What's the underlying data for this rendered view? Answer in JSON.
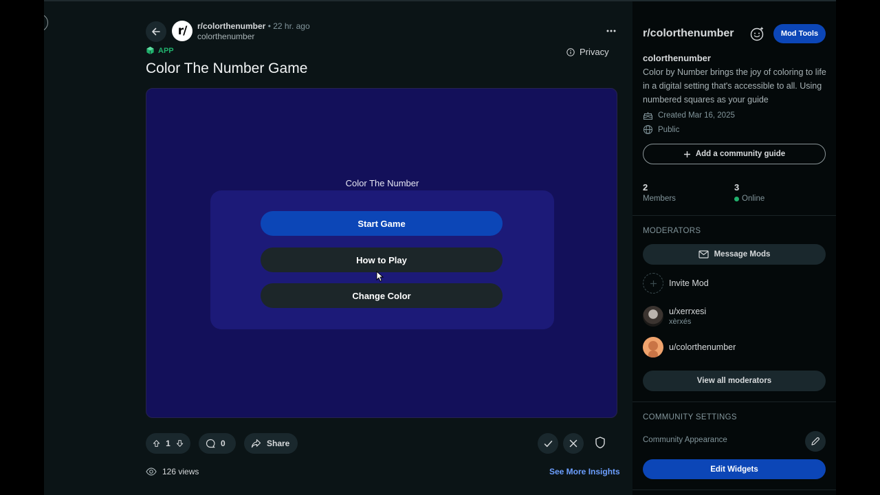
{
  "post": {
    "subreddit": "r/colorthenumber",
    "separator": "•",
    "time": "22 hr. ago",
    "author": "colorthenumber",
    "avatar_text": "r/",
    "badge": "APP",
    "privacy_label": "Privacy",
    "title": "Color The Number Game"
  },
  "game": {
    "title": "Color The Number",
    "buttons": {
      "start": "Start Game",
      "how_to_play": "How to Play",
      "change_color": "Change Color"
    },
    "colors": {
      "background": "#13105a",
      "panel": "#1c1a78",
      "primary": "#0c46b7"
    }
  },
  "actions": {
    "votes": "1",
    "comments": "0",
    "share": "Share",
    "views": "126 views",
    "insights": "See More Insights"
  },
  "sidebar": {
    "title": "r/colorthenumber",
    "mod_tools": "Mod Tools",
    "name": "colorthenumber",
    "description": "Color by Number brings the joy of coloring to life in a digital setting that's accessible to all. Using numbered squares as your guide",
    "created": "Created Mar 16, 2025",
    "visibility": "Public",
    "guide_button": "Add a community guide",
    "members_count": "2",
    "members_label": "Members",
    "online_count": "3",
    "online_label": "Online",
    "moderators_heading": "MODERATORS",
    "message_mods": "Message Mods",
    "invite_mod": "Invite Mod",
    "mods": [
      {
        "name": "u/xerrxesi",
        "display": "xèrxés"
      },
      {
        "name": "u/colorthenumber"
      }
    ],
    "view_all_mods": "View all moderators",
    "settings_heading": "COMMUNITY SETTINGS",
    "appearance": "Community Appearance",
    "edit_widgets": "Edit Widgets"
  },
  "colors": {
    "accent": "#0c46b7",
    "link": "#6c9fff",
    "app_badge": "#21b16d",
    "online": "#21b16d"
  }
}
